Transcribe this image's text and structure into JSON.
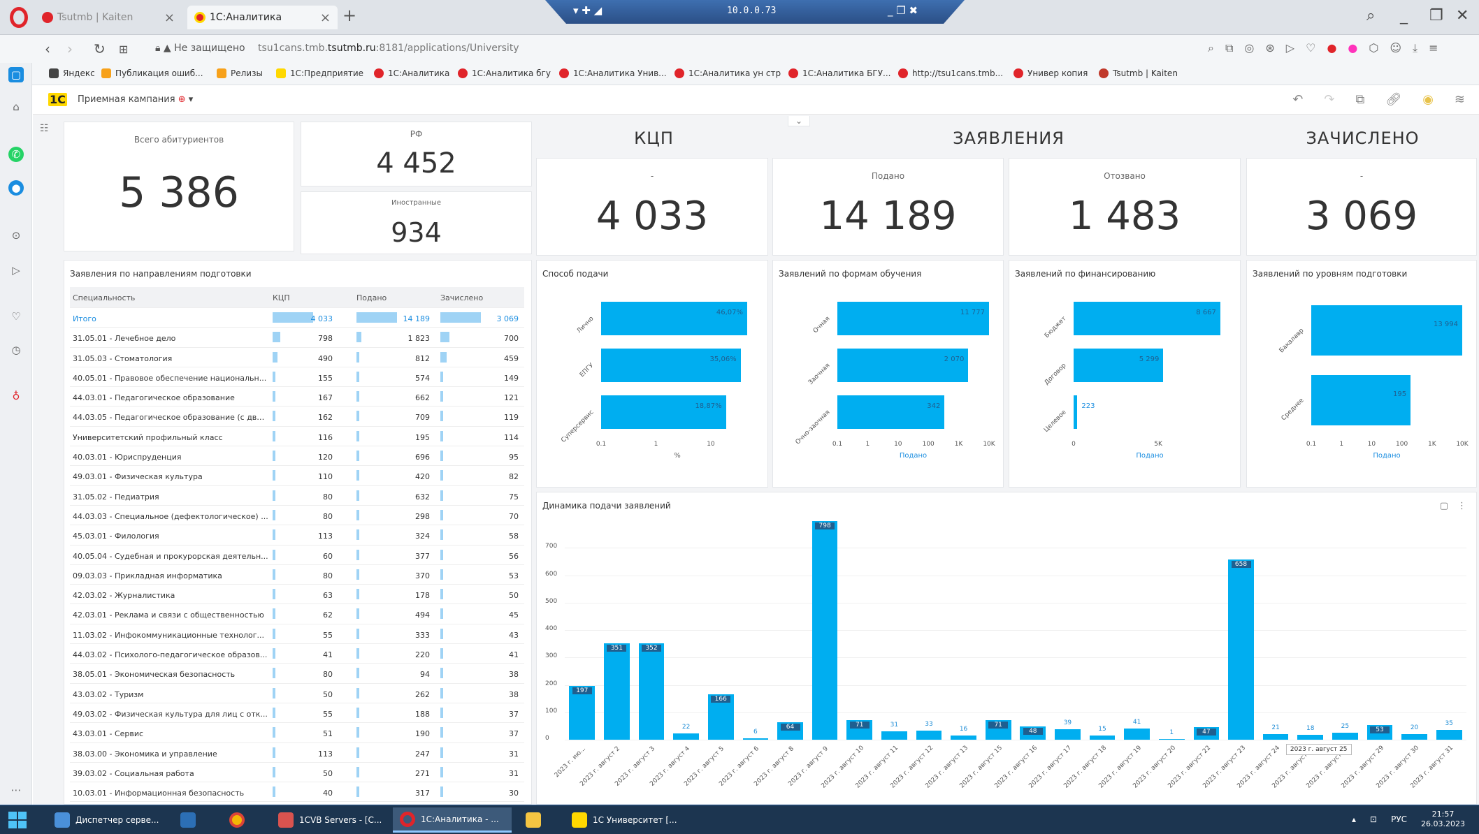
{
  "browser": {
    "tabs": [
      {
        "title": "Tsutmb | Kaiten"
      },
      {
        "title": "1С:Аналитика"
      }
    ],
    "remote_ip": "10.0.0.73",
    "url_warning": "Не защищено",
    "url_prefix": "tsu1cans.tmb.",
    "url_host": "tsutmb.ru",
    "url_path": ":8181/applications/University",
    "bookmarks": [
      "Яндекс",
      "Публикация ошиб...",
      "Релизы",
      "1С:Предприятие",
      "1С:Аналитика",
      "1С:Аналитика бгу",
      "1С:Аналитика Унив...",
      "1С:Аналитика ун стр",
      "1С:Аналитика БГУ...",
      "http://tsu1cans.tmb...",
      "Универ копия",
      "Tsutmb | Kaiten"
    ]
  },
  "app": {
    "logo": "1С",
    "campaign": "Приемная кампания"
  },
  "kpi": {
    "total_label": "Всего абитуриентов",
    "total_value": "5 386",
    "rf_label": "РФ",
    "rf_value": "4 452",
    "foreign_label": "Иностранные",
    "foreign_value": "934",
    "sections": {
      "kcp": "КЦП",
      "applications": "ЗАЯВЛЕНИЯ",
      "enrolled": "ЗАЧИСЛЕНО"
    },
    "kcp_label": "-",
    "kcp_value": "4 033",
    "submitted_label": "Подано",
    "submitted_value": "14 189",
    "withdrawn_label": "Отозвано",
    "withdrawn_value": "1 483",
    "enrolled_label": "-",
    "enrolled_value": "3 069"
  },
  "table": {
    "title": "Заявления по направлениям подготовки",
    "columns": [
      "Специальность",
      "КЦП",
      "Подано",
      "Зачислено"
    ],
    "rows": [
      {
        "name": "Итого",
        "kcp": "4 033",
        "sub": "14 189",
        "enr": "3 069",
        "kcp_n": 4033,
        "sub_n": 14189,
        "enr_n": 3069,
        "total": true
      },
      {
        "name": "31.05.01 - Лечебное дело",
        "kcp": "798",
        "sub": "1 823",
        "enr": "700",
        "kcp_n": 798,
        "sub_n": 1823,
        "enr_n": 700
      },
      {
        "name": "31.05.03 - Стоматология",
        "kcp": "490",
        "sub": "812",
        "enr": "459",
        "kcp_n": 490,
        "sub_n": 812,
        "enr_n": 459
      },
      {
        "name": "40.05.01 - Правовое обеспечение национальн...",
        "kcp": "155",
        "sub": "574",
        "enr": "149",
        "kcp_n": 155,
        "sub_n": 574,
        "enr_n": 149
      },
      {
        "name": "44.03.01 - Педагогическое образование",
        "kcp": "167",
        "sub": "662",
        "enr": "121",
        "kcp_n": 167,
        "sub_n": 662,
        "enr_n": 121
      },
      {
        "name": "44.03.05 - Педагогическое образование (с дву...",
        "kcp": "162",
        "sub": "709",
        "enr": "119",
        "kcp_n": 162,
        "sub_n": 709,
        "enr_n": 119
      },
      {
        "name": "Университетский профильный класс",
        "kcp": "116",
        "sub": "195",
        "enr": "114",
        "kcp_n": 116,
        "sub_n": 195,
        "enr_n": 114
      },
      {
        "name": "40.03.01 - Юриспруденция",
        "kcp": "120",
        "sub": "696",
        "enr": "95",
        "kcp_n": 120,
        "sub_n": 696,
        "enr_n": 95
      },
      {
        "name": "49.03.01 - Физическая культура",
        "kcp": "110",
        "sub": "420",
        "enr": "82",
        "kcp_n": 110,
        "sub_n": 420,
        "enr_n": 82
      },
      {
        "name": "31.05.02 - Педиатрия",
        "kcp": "80",
        "sub": "632",
        "enr": "75",
        "kcp_n": 80,
        "sub_n": 632,
        "enr_n": 75
      },
      {
        "name": "44.03.03 - Специальное (дефектологическое) ...",
        "kcp": "80",
        "sub": "298",
        "enr": "70",
        "kcp_n": 80,
        "sub_n": 298,
        "enr_n": 70
      },
      {
        "name": "45.03.01 - Филология",
        "kcp": "113",
        "sub": "324",
        "enr": "58",
        "kcp_n": 113,
        "sub_n": 324,
        "enr_n": 58
      },
      {
        "name": "40.05.04 - Судебная и прокурорская деятельн...",
        "kcp": "60",
        "sub": "377",
        "enr": "56",
        "kcp_n": 60,
        "sub_n": 377,
        "enr_n": 56
      },
      {
        "name": "09.03.03 - Прикладная информатика",
        "kcp": "80",
        "sub": "370",
        "enr": "53",
        "kcp_n": 80,
        "sub_n": 370,
        "enr_n": 53
      },
      {
        "name": "42.03.02 - Журналистика",
        "kcp": "63",
        "sub": "178",
        "enr": "50",
        "kcp_n": 63,
        "sub_n": 178,
        "enr_n": 50
      },
      {
        "name": "42.03.01 - Реклама и связи с общественностью",
        "kcp": "62",
        "sub": "494",
        "enr": "45",
        "kcp_n": 62,
        "sub_n": 494,
        "enr_n": 45
      },
      {
        "name": "11.03.02 - Инфокоммуникационные технолог...",
        "kcp": "55",
        "sub": "333",
        "enr": "43",
        "kcp_n": 55,
        "sub_n": 333,
        "enr_n": 43
      },
      {
        "name": "44.03.02 - Психолого-педагогическое образов...",
        "kcp": "41",
        "sub": "220",
        "enr": "41",
        "kcp_n": 41,
        "sub_n": 220,
        "enr_n": 41
      },
      {
        "name": "38.05.01 - Экономическая безопасность",
        "kcp": "80",
        "sub": "94",
        "enr": "38",
        "kcp_n": 80,
        "sub_n": 94,
        "enr_n": 38
      },
      {
        "name": "43.03.02 - Туризм",
        "kcp": "50",
        "sub": "262",
        "enr": "38",
        "kcp_n": 50,
        "sub_n": 262,
        "enr_n": 38
      },
      {
        "name": "49.03.02 - Физическая культура для лиц с отк...",
        "kcp": "55",
        "sub": "188",
        "enr": "37",
        "kcp_n": 55,
        "sub_n": 188,
        "enr_n": 37
      },
      {
        "name": "43.03.01 - Сервис",
        "kcp": "51",
        "sub": "190",
        "enr": "37",
        "kcp_n": 51,
        "sub_n": 190,
        "enr_n": 37
      },
      {
        "name": "38.03.00 - Экономика и управление",
        "kcp": "113",
        "sub": "247",
        "enr": "31",
        "kcp_n": 113,
        "sub_n": 247,
        "enr_n": 31
      },
      {
        "name": "39.03.02 - Социальная работа",
        "kcp": "50",
        "sub": "271",
        "enr": "31",
        "kcp_n": 50,
        "sub_n": 271,
        "enr_n": 31
      },
      {
        "name": "10.03.01 - Информационная безопасность",
        "kcp": "40",
        "sub": "317",
        "enr": "30",
        "kcp_n": 40,
        "sub_n": 317,
        "enr_n": 30
      }
    ]
  },
  "chart_data": [
    {
      "type": "bar",
      "orientation": "horizontal",
      "title": "Способ подачи",
      "categories": [
        "Лично",
        "ЕПГУ",
        "Суперсервис"
      ],
      "values": [
        46.07,
        35.06,
        18.87
      ],
      "value_labels": [
        "46,07%",
        "35,06%",
        "18,87%"
      ],
      "xscale": "log",
      "xticks": [
        "0.1",
        "1",
        "10"
      ],
      "xlabel": "%"
    },
    {
      "type": "bar",
      "orientation": "horizontal",
      "title": "Заявлений по формам обучения",
      "categories": [
        "Очная",
        "Заочная",
        "Очно-заочная"
      ],
      "values": [
        11777,
        2070,
        342
      ],
      "value_labels": [
        "11 777",
        "2 070",
        "342"
      ],
      "xscale": "log",
      "xticks": [
        "0.1",
        "1",
        "10",
        "100",
        "1K",
        "10K"
      ],
      "xlabel": "Подано"
    },
    {
      "type": "bar",
      "orientation": "horizontal",
      "title": "Заявлений по финансированию",
      "categories": [
        "Бюджет",
        "Договор",
        "Целевое"
      ],
      "values": [
        8667,
        5299,
        223
      ],
      "value_labels": [
        "8 667",
        "5 299",
        "223"
      ],
      "xticks": [
        "0",
        "5K"
      ],
      "xlim": [
        0,
        9000
      ],
      "xlabel": "Подано"
    },
    {
      "type": "bar",
      "orientation": "horizontal",
      "title": "Заявлений по уровням подготовки",
      "categories": [
        "Бакалавр",
        "Среднее"
      ],
      "values": [
        13994,
        195
      ],
      "value_labels": [
        "13 994",
        "195"
      ],
      "xscale": "log",
      "xticks": [
        "0.1",
        "1",
        "10",
        "100",
        "1K",
        "10K"
      ],
      "xlabel": "Подано"
    },
    {
      "type": "bar",
      "title": "Динамика подачи заявлений",
      "categories": [
        "2023 г. ию...",
        "2023 г. август 2",
        "2023 г. август 3",
        "2023 г. август 4",
        "2023 г. август 5",
        "2023 г. август 6",
        "2023 г. август 8",
        "2023 г. август 9",
        "2023 г. август 10",
        "2023 г. август 11",
        "2023 г. август 12",
        "2023 г. август 13",
        "2023 г. август 15",
        "2023 г. август 16",
        "2023 г. август 17",
        "2023 г. август 18",
        "2023 г. август 19",
        "2023 г. август 20",
        "2023 г. август 22",
        "2023 г. август 23",
        "2023 г. август 24",
        "2023 г. август 25",
        "2023 г. август 26",
        "2023 г. август 29",
        "2023 г. август 30",
        "2023 г. август 31"
      ],
      "values": [
        197,
        351,
        352,
        22,
        166,
        6,
        64,
        798,
        71,
        31,
        33,
        16,
        71,
        48,
        39,
        15,
        41,
        1,
        47,
        658,
        21,
        18,
        25,
        53,
        20,
        35
      ],
      "yticks": [
        "0",
        "100",
        "200",
        "300",
        "400",
        "500",
        "600",
        "700"
      ],
      "ylim": [
        0,
        800
      ],
      "tooltip": "2023 г. август 25"
    }
  ],
  "taskbar": {
    "items": [
      "Диспетчер серве...",
      "",
      "",
      "1CVB Servers - [C...",
      "1С:Аналитика - ...",
      "",
      "1С Университет [..."
    ],
    "lang": "РУС",
    "time": "21:57",
    "date": "26.03.2023"
  }
}
